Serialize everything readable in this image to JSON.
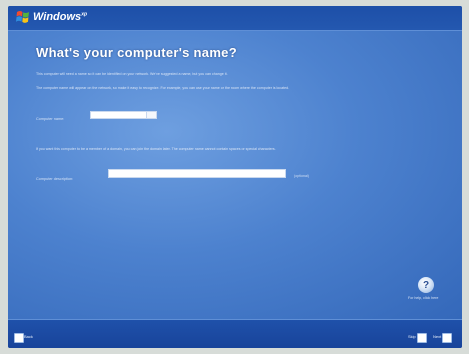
{
  "brand": {
    "name": "Windows",
    "trademark": "xp"
  },
  "page": {
    "title": "What's your computer's name?",
    "paragraph1": "This computer will need a name so it can be identified on your network. We've suggested a name, but you can change it.",
    "paragraph2": "The computer name will appear on the network, so make it easy to recognize. For example, you can use your name or the room where the computer is located.",
    "paragraph3": "If you want this computer to be a member of a domain, you can join the domain later. The computer name cannot contain spaces or special characters.",
    "name_label": "Computer name:",
    "name_value": "",
    "description_label": "Computer description:",
    "description_value": "",
    "description_hint": "(optional)"
  },
  "help": {
    "label": "For help, click here",
    "icon": "help-icon"
  },
  "footer": {
    "back_label": "Back",
    "skip_label": "Skip",
    "next_label": "Next"
  },
  "colors": {
    "background": "#2f63b6",
    "content_glow": "#6e9fe0",
    "bar": "#1d4fa8"
  }
}
